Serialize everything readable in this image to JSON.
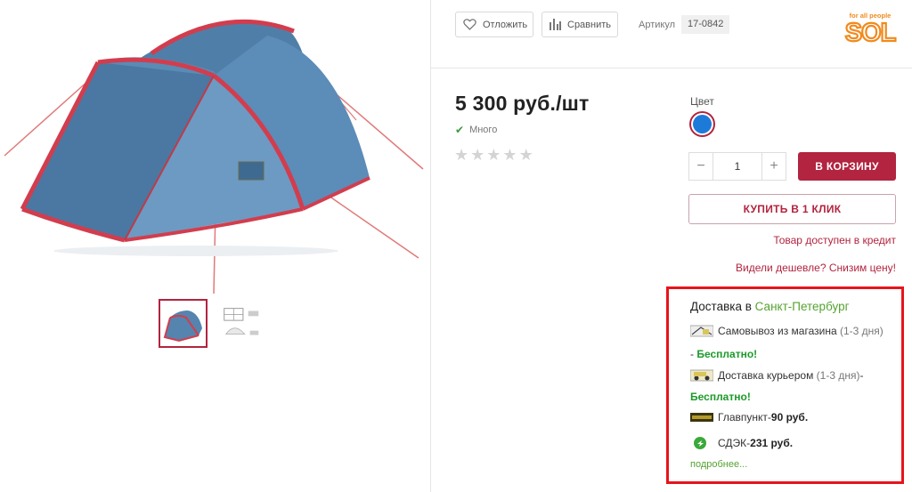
{
  "actions": {
    "defer_label": "Отложить",
    "compare_label": "Сравнить",
    "article_label": "Артикул",
    "article_value": "17-0842"
  },
  "brand": {
    "tagline": "for all people",
    "name": "SOL"
  },
  "product": {
    "price": "5 300 руб./шт",
    "stock": "Много",
    "rating_stars": 5,
    "rating_value": 0
  },
  "color": {
    "label": "Цвет",
    "selected_hex": "#1d7ad8"
  },
  "quantity": {
    "value": "1",
    "minus": "−",
    "plus": "+"
  },
  "buttons": {
    "to_cart": "В КОРЗИНУ",
    "one_click": "КУПИТЬ В 1 КЛИК"
  },
  "links": {
    "credit": "Товар доступен в кредит",
    "cheaper": "Видели дешевле? Снизим цену!"
  },
  "delivery": {
    "title_prefix": "Доставка в ",
    "city": "Санкт-Петербург",
    "pickup": {
      "label": "Самовывоз из магазина",
      "term": "(1-3 дня)",
      "dash": "- ",
      "price": "Бесплатно!"
    },
    "courier": {
      "label": "Доставка курьером",
      "term": "(1-3 дня)",
      "dash": " -",
      "price": "Бесплатно!"
    },
    "glavpunkt": {
      "label": "Главпункт",
      "dash": " - ",
      "price": "90 руб."
    },
    "cdek": {
      "label": "СДЭК",
      "dash": " - ",
      "price": "231 руб."
    },
    "more": "подробнее..."
  },
  "colors": {
    "accent": "#b2243f",
    "highlight_border": "#e8131b",
    "green": "#55a331",
    "free_green": "#1c9a2a"
  }
}
